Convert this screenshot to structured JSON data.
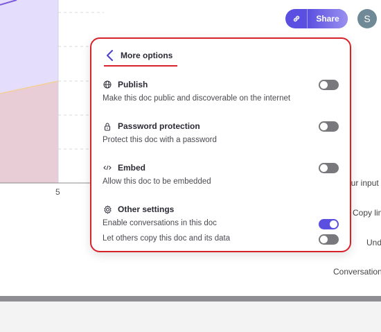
{
  "toolbar": {
    "share_label": "Share",
    "avatar_initial": "S",
    "link_icon": "link-icon"
  },
  "background": {
    "x_tick": "5",
    "right_texts": [
      "our input",
      "Copy lin",
      "Und",
      "Conversation"
    ]
  },
  "popup": {
    "title": "More options",
    "sections": [
      {
        "icon": "globe-icon",
        "title": "Publish",
        "description": "Make this doc public and discoverable on the internet",
        "toggle_on": false
      },
      {
        "icon": "lock-icon",
        "title": "Password protection",
        "description": "Protect this doc with a password",
        "toggle_on": false
      },
      {
        "icon": "code-icon",
        "title": "Embed",
        "description": "Allow this doc to be embedded",
        "toggle_on": false
      }
    ],
    "other": {
      "icon": "gear-icon",
      "title": "Other settings",
      "options": [
        {
          "label": "Enable conversations in this doc",
          "toggle_on": true
        },
        {
          "label": "Let others copy this doc and its data",
          "toggle_on": false
        }
      ]
    }
  },
  "colors": {
    "accent": "#5a4fe0",
    "highlight_border": "#d8222a",
    "toggle_off": "#78787d"
  }
}
